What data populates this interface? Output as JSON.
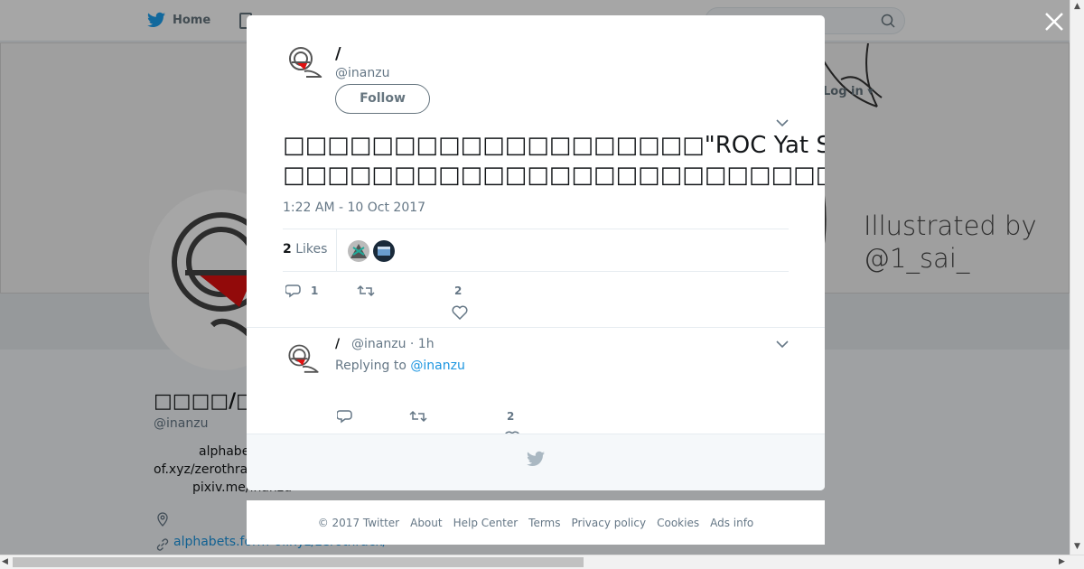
{
  "nav": {
    "home_label": "Home",
    "login_label": "Log in"
  },
  "banner": {
    "credit_line1": "Illustrated by",
    "credit_line2": "@1_sai_"
  },
  "profile": {
    "name": "□□□□/□□□□",
    "handle": "@inanzu",
    "bio_line1": "alphabe",
    "bio_line2": "of.xyz/zerothra",
    "bio_line3": "pixiv.me/inanzu",
    "url": "alphabets.form-of.xyz/zerothrack/"
  },
  "modal": {
    "author_name": "/",
    "author_handle": "@inanzu",
    "follow_label": "Follow",
    "tweet_line1": "□□□□□□□□□□□□□□□□□□□\"ROC Yat Sen\"□□□□□□□□□□□□□□□ROC□□□□□□□□□",
    "tweet_line2": "□□□□□□□□□□□□□□□□□□□□□□□□□□□□□□□□",
    "timestamp": "1:22 AM - 10 Oct 2017",
    "likes_number": "2",
    "likes_label": "Likes",
    "reply_count": "1",
    "like_count": "2",
    "reply": {
      "name": "/",
      "meta": "@inanzu · 1h",
      "replying_prefix": "Replying to",
      "replying_handle": "@inanzu",
      "like_count": "2"
    }
  },
  "footer": {
    "copyright": "© 2017 Twitter",
    "links": [
      "About",
      "Help Center",
      "Terms",
      "Privacy policy",
      "Cookies",
      "Ads info"
    ]
  },
  "colors": {
    "twitter_blue": "#1da1f2",
    "text_secondary": "#657786",
    "link": "#1b95e0"
  }
}
